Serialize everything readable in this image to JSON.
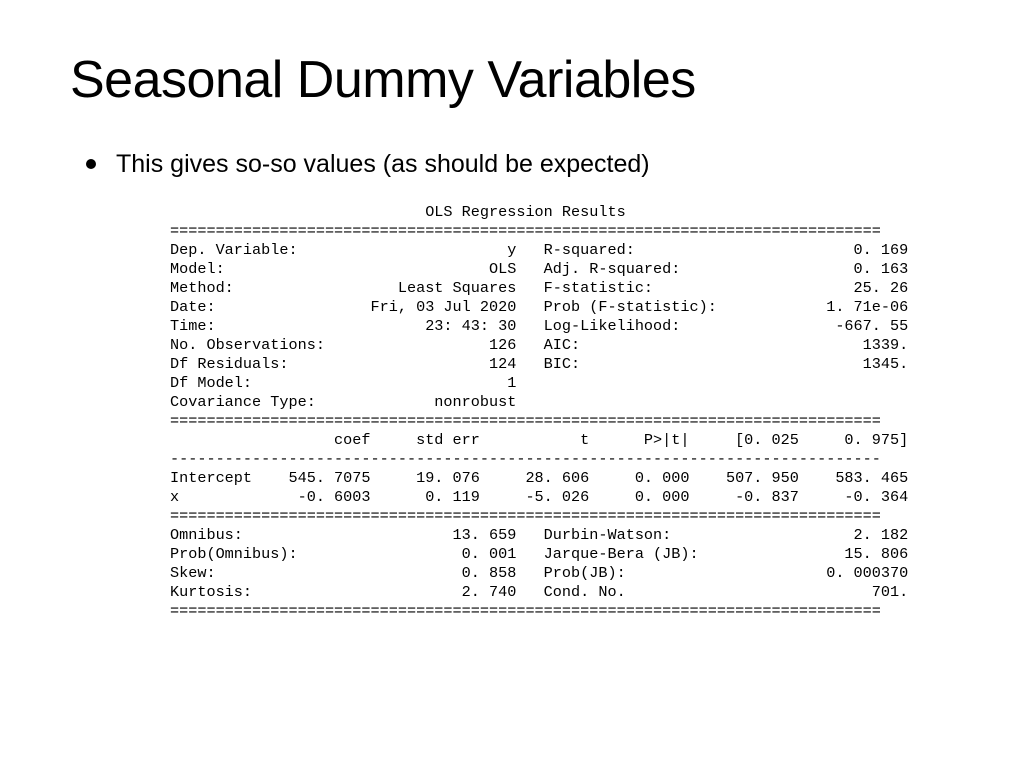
{
  "title": "Seasonal Dummy Variables",
  "bullet": "This gives so-so values (as should be expected)",
  "ols": {
    "heading": "OLS Regression Results",
    "sep": "==============================================================================",
    "dash": "------------------------------------------------------------------------------",
    "summary_left": [
      [
        "Dep. Variable:",
        "y"
      ],
      [
        "Model:",
        "OLS"
      ],
      [
        "Method:",
        "Least Squares"
      ],
      [
        "Date:",
        "Fri, 03 Jul 2020"
      ],
      [
        "Time:",
        "23: 43: 30"
      ],
      [
        "No. Observations:",
        "126"
      ],
      [
        "Df Residuals:",
        "124"
      ],
      [
        "Df Model:",
        "1"
      ],
      [
        "Covariance Type:",
        "nonrobust"
      ]
    ],
    "summary_right": [
      [
        "R-squared:",
        "0. 169"
      ],
      [
        "Adj. R-squared:",
        "0. 163"
      ],
      [
        "F-statistic:",
        "25. 26"
      ],
      [
        "Prob (F-statistic):",
        "1. 71e-06"
      ],
      [
        "Log-Likelihood:",
        "-667. 55"
      ],
      [
        "AIC:",
        "1339."
      ],
      [
        "BIC:",
        "1345."
      ]
    ],
    "coef_header": [
      "",
      "coef",
      "std err",
      "t",
      "P>|t|",
      "[0. 025",
      "0. 975]"
    ],
    "coef_rows": [
      [
        "Intercept",
        "545. 7075",
        "19. 076",
        "28. 606",
        "0. 000",
        "507. 950",
        "583. 465"
      ],
      [
        "x",
        "-0. 6003",
        "0. 119",
        "-5. 026",
        "0. 000",
        "-0. 837",
        "-0. 364"
      ]
    ],
    "diag_left": [
      [
        "Omnibus:",
        "13. 659"
      ],
      [
        "Prob(Omnibus):",
        "0. 001"
      ],
      [
        "Skew:",
        "0. 858"
      ],
      [
        "Kurtosis:",
        "2. 740"
      ]
    ],
    "diag_right": [
      [
        "Durbin-Watson:",
        "2. 182"
      ],
      [
        "Jarque-Bera (JB):",
        "15. 806"
      ],
      [
        "Prob(JB):",
        "0. 000370"
      ],
      [
        "Cond. No.",
        "701."
      ]
    ]
  }
}
